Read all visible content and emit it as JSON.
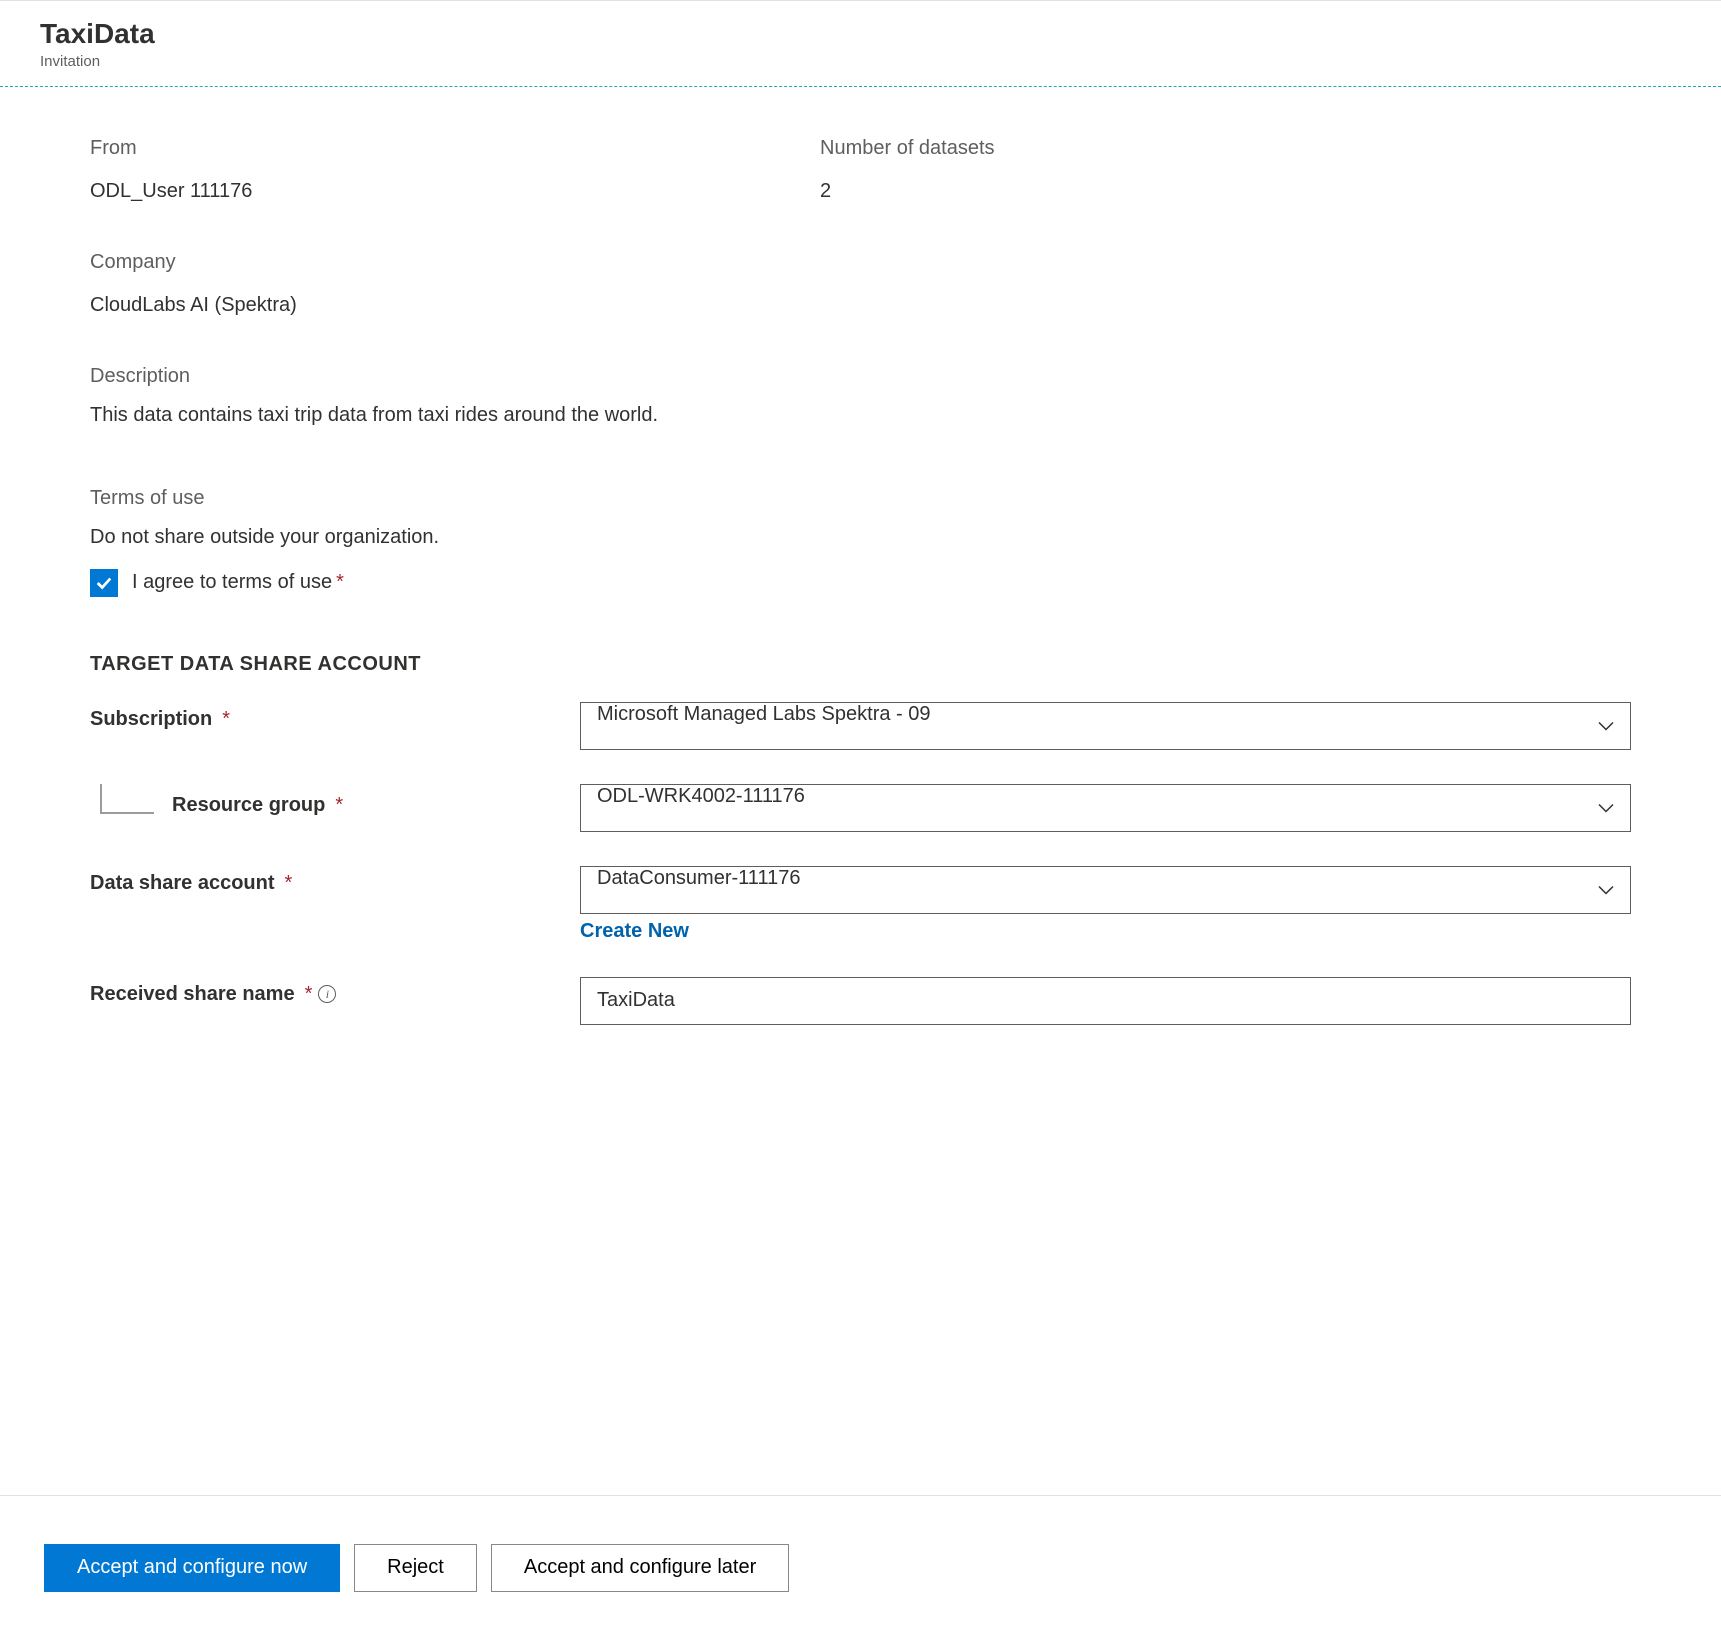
{
  "header": {
    "title": "TaxiData",
    "subtitle": "Invitation"
  },
  "info": {
    "from_label": "From",
    "from_value": "ODL_User 111176",
    "datasets_label": "Number of datasets",
    "datasets_value": "2",
    "company_label": "Company",
    "company_value": "CloudLabs AI (Spektra)"
  },
  "description": {
    "label": "Description",
    "value": "This data contains taxi trip data from taxi rides around the world."
  },
  "terms": {
    "title": "Terms of use",
    "text": "Do not share outside your organization.",
    "checkbox_label": "I agree to terms of use"
  },
  "target": {
    "heading": "TARGET DATA SHARE ACCOUNT",
    "subscription_label": "Subscription",
    "subscription_value": "Microsoft Managed Labs Spektra - 09",
    "rg_label": "Resource group",
    "rg_value": "ODL-WRK4002-111176",
    "dsa_label": "Data share account",
    "dsa_value": "DataConsumer-111176",
    "create_new": "Create New",
    "rsn_label": "Received share name",
    "rsn_value": "TaxiData"
  },
  "footer": {
    "primary": "Accept and configure now",
    "reject": "Reject",
    "later": "Accept and configure later"
  }
}
